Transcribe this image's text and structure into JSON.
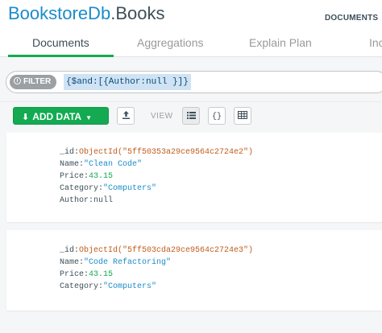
{
  "header": {
    "database": "BookstoreDb",
    "separator": ".",
    "collection": "Books",
    "section_label": "DOCUMENTS"
  },
  "tabs": [
    {
      "label": "Documents",
      "active": true
    },
    {
      "label": "Aggregations",
      "active": false
    },
    {
      "label": "Explain Plan",
      "active": false
    },
    {
      "label": "Inc",
      "active": false
    }
  ],
  "filter": {
    "pill_label": "FILTER",
    "query": "{$and:[{Author:null }]}"
  },
  "actions": {
    "add_data_label": "ADD DATA",
    "view_label": "VIEW"
  },
  "documents": [
    {
      "fields": [
        {
          "key": "_id:",
          "value": "ObjectId(\"5ff50353a29ce9564c2724e2\")",
          "type": "oid"
        },
        {
          "key": "Name:",
          "value": "\"Clean Code\"",
          "type": "str"
        },
        {
          "key": "Price:",
          "value": "43.15",
          "type": "num"
        },
        {
          "key": "Category:",
          "value": "\"Computers\"",
          "type": "str"
        },
        {
          "key": "Author:",
          "value": "null",
          "type": "null"
        }
      ]
    },
    {
      "fields": [
        {
          "key": "_id:",
          "value": "ObjectId(\"5ff503cda29ce9564c2724e3\")",
          "type": "oid"
        },
        {
          "key": "Name:",
          "value": "\"Code Refactoring\"",
          "type": "str"
        },
        {
          "key": "Price:",
          "value": "43.15",
          "type": "num"
        },
        {
          "key": "Category:",
          "value": "\"Computers\"",
          "type": "str"
        }
      ]
    }
  ],
  "colors": {
    "accent_green": "#13aa52",
    "link_blue": "#1a8cc9",
    "objectid_orange": "#c05c1c"
  }
}
